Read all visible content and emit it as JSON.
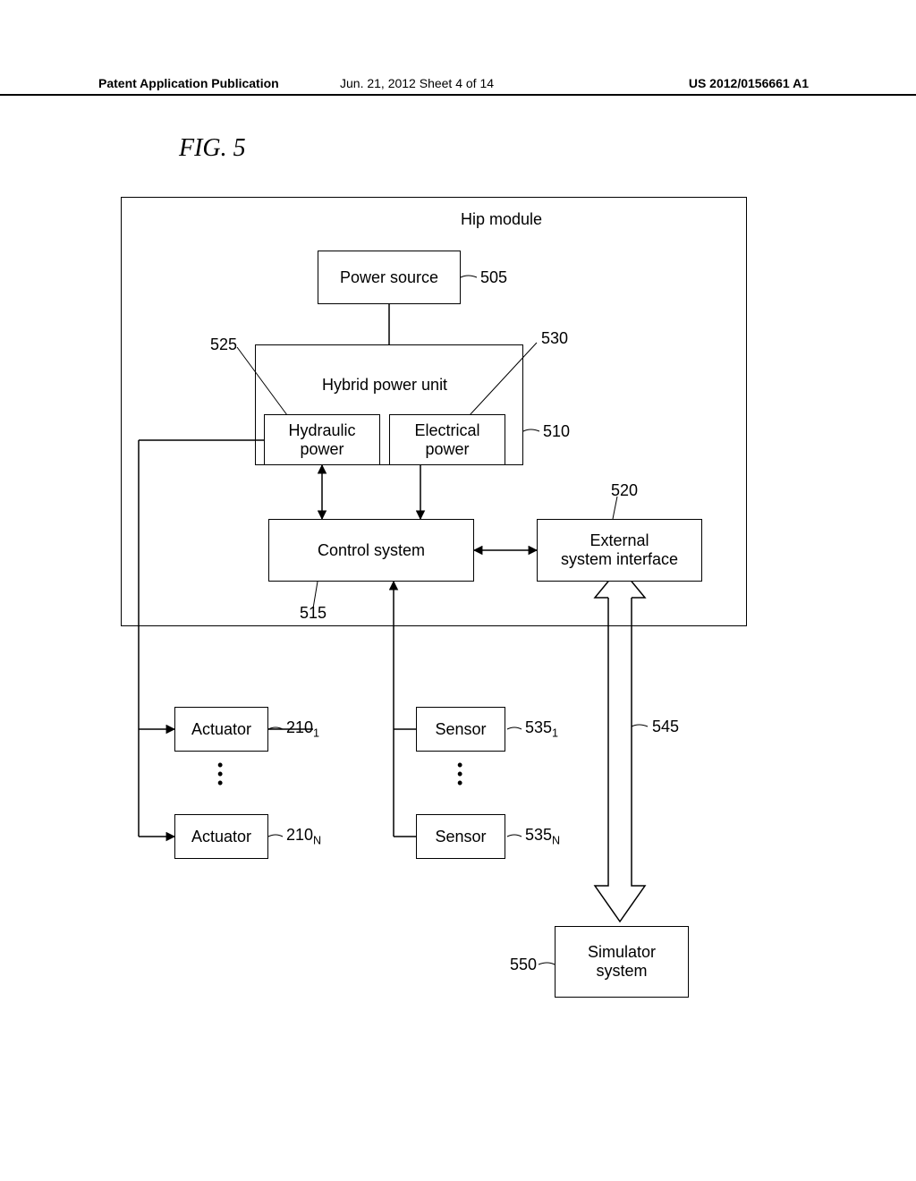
{
  "header": {
    "left": "Patent Application Publication",
    "center": "Jun. 21, 2012  Sheet 4 of 14",
    "right": "US 2012/0156661 A1"
  },
  "figure_title": "FIG. 5",
  "diagram": {
    "hip_module_label": "Hip module",
    "power_source": "Power source",
    "hybrid_power_unit": "Hybrid power unit",
    "hydraulic_power": "Hydraulic\npower",
    "electrical_power": "Electrical\npower",
    "control_system": "Control system",
    "external_interface": "External\nsystem interface",
    "actuator": "Actuator",
    "sensor": "Sensor",
    "simulator": "Simulator\nsystem",
    "ref_505": "505",
    "ref_510": "510",
    "ref_515": "515",
    "ref_520": "520",
    "ref_525": "525",
    "ref_530": "530",
    "ref_545": "545",
    "ref_550": "550",
    "ref_210_1": "210<sub>1</sub>",
    "ref_210_N": "210<sub>N</sub>",
    "ref_535_1": "535<sub>1</sub>",
    "ref_535_N": "535<sub>N</sub>"
  }
}
